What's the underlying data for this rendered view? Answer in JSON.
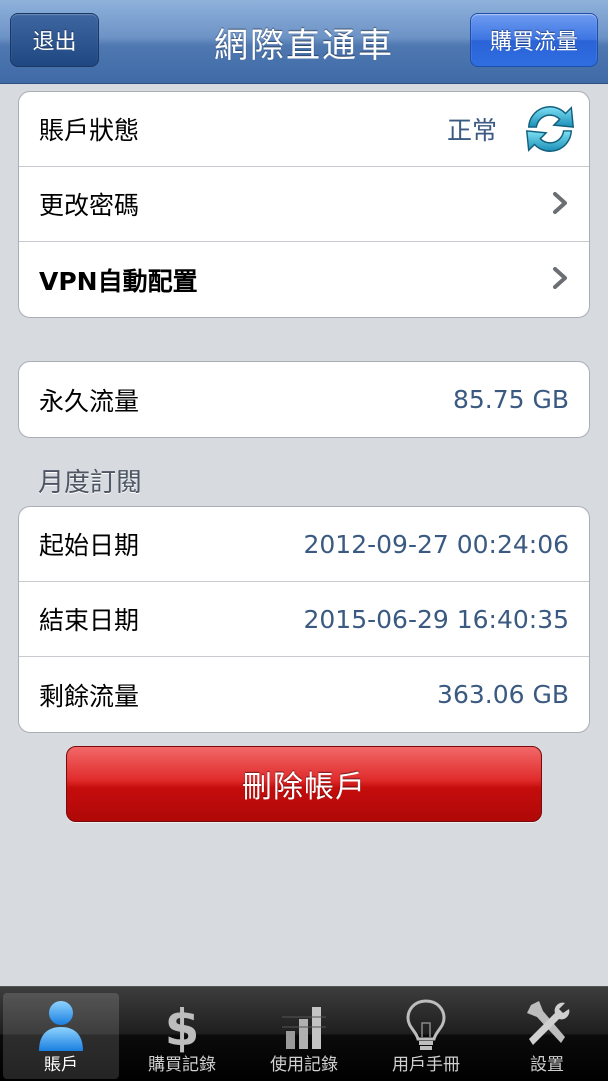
{
  "navbar": {
    "title": "網際直通車",
    "logout_label": "退出",
    "buy_label": "購買流量"
  },
  "account_group": {
    "status_label": "賬戶狀態",
    "status_value": "正常",
    "change_password_label": "更改密碼",
    "vpn_config_label": "VPN自動配置"
  },
  "permanent_group": {
    "label": "永久流量",
    "value": "85.75 GB"
  },
  "monthly": {
    "header": "月度訂閱",
    "start_label": "起始日期",
    "start_value": "2012-09-27 00:24:06",
    "end_label": "結束日期",
    "end_value": "2015-06-29 16:40:35",
    "remaining_label": "剩餘流量",
    "remaining_value": "363.06 GB"
  },
  "delete_label": "刪除帳戶",
  "tabs": [
    {
      "label": "賬戶",
      "icon": "user-icon",
      "active": true
    },
    {
      "label": "購買記錄",
      "icon": "dollar-icon",
      "active": false
    },
    {
      "label": "使用記錄",
      "icon": "bar-chart-icon",
      "active": false
    },
    {
      "label": "用戶手冊",
      "icon": "lightbulb-icon",
      "active": false
    },
    {
      "label": "設置",
      "icon": "tools-icon",
      "active": false
    }
  ],
  "colors": {
    "navbar": "#4f78b1",
    "value_text": "#3b5a82",
    "delete": "#c50d0d",
    "background": "#d7dadf"
  }
}
